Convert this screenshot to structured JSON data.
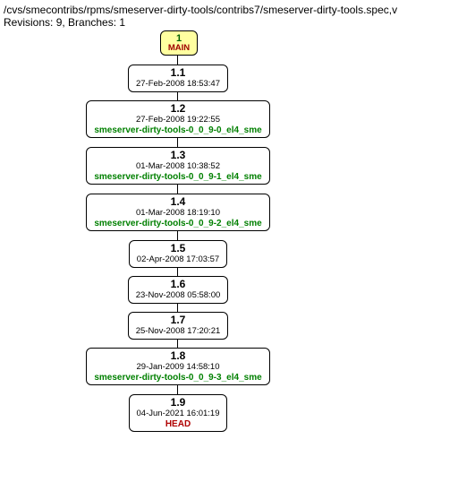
{
  "header": {
    "path": "/cvs/smecontribs/rpms/smeserver-dirty-tools/contribs7/smeserver-dirty-tools.spec,v",
    "revisions_line": "Revisions: 9, Branches: 1"
  },
  "root": {
    "number": "1",
    "branch": "MAIN"
  },
  "nodes": [
    {
      "version": "1.1",
      "date": "27-Feb-2008 18:53:47",
      "tag": ""
    },
    {
      "version": "1.2",
      "date": "27-Feb-2008 19:22:55",
      "tag": "smeserver-dirty-tools-0_0_9-0_el4_sme"
    },
    {
      "version": "1.3",
      "date": "01-Mar-2008 10:38:52",
      "tag": "smeserver-dirty-tools-0_0_9-1_el4_sme"
    },
    {
      "version": "1.4",
      "date": "01-Mar-2008 18:19:10",
      "tag": "smeserver-dirty-tools-0_0_9-2_el4_sme"
    },
    {
      "version": "1.5",
      "date": "02-Apr-2008 17:03:57",
      "tag": ""
    },
    {
      "version": "1.6",
      "date": "23-Nov-2008 05:58:00",
      "tag": ""
    },
    {
      "version": "1.7",
      "date": "25-Nov-2008 17:20:21",
      "tag": ""
    },
    {
      "version": "1.8",
      "date": "29-Jan-2009 14:58:10",
      "tag": "smeserver-dirty-tools-0_0_9-3_el4_sme"
    },
    {
      "version": "1.9",
      "date": "04-Jun-2021 16:01:19",
      "tag": "",
      "head": "HEAD"
    }
  ]
}
